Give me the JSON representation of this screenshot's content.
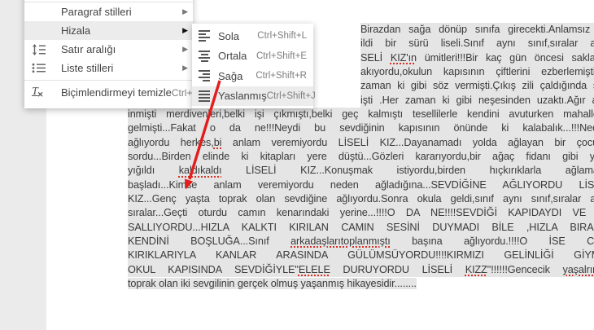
{
  "context_menu": {
    "items": [
      {
        "label": "Paragraf stilleri",
        "shortcut": "",
        "icon": "none",
        "has_submenu": true,
        "highlighted": false
      },
      {
        "label": "Hizala",
        "shortcut": "",
        "icon": "none",
        "has_submenu": true,
        "highlighted": true
      },
      {
        "label": "Satır aralığı",
        "shortcut": "",
        "icon": "line-spacing-icon",
        "has_submenu": true,
        "highlighted": false
      },
      {
        "label": "Liste stilleri",
        "shortcut": "",
        "icon": "list-icon",
        "has_submenu": true,
        "highlighted": false
      },
      {
        "label": "Biçimlendirmeyi temizle",
        "shortcut": "Ctrl+\\",
        "icon": "clear-formatting-icon",
        "has_submenu": false,
        "highlighted": false
      }
    ]
  },
  "align_submenu": {
    "items": [
      {
        "label": "Sola",
        "shortcut": "Ctrl+Shift+L",
        "icon": "align-left-icon",
        "highlighted": false
      },
      {
        "label": "Ortala",
        "shortcut": "Ctrl+Shift+E",
        "icon": "align-center-icon",
        "highlighted": false
      },
      {
        "label": "Sağa",
        "shortcut": "Ctrl+Shift+R",
        "icon": "align-right-icon",
        "highlighted": false
      },
      {
        "label": "Yaslanmış",
        "shortcut": "Ctrl+Shift+J",
        "icon": "align-justify-icon",
        "highlighted": true
      }
    ]
  },
  "document": {
    "selection_color": "#e5e5e5",
    "text_color": "#3a3a3a",
    "spellcheck_color": "#d93025",
    "fragment_lines": [
      [
        [
          "Birazdan sağa dönüp sınıfa girecekti.Anlamsız bir",
          false
        ]
      ],
      [
        [
          "ildi bir sürü liseli.Sınıf aynı sınıf,sıralar aynı",
          false
        ]
      ],
      [
        [
          "SELİ ",
          false
        ],
        [
          "KIZ'ın",
          true
        ],
        [
          " ümitleri!!!Bir kaç gün öncesi saklandı",
          false
        ]
      ],
      [
        [
          "akıyordu,okulun kapısının çiftlerini ezberlemişti,ne",
          false
        ]
      ],
      [
        [
          "zaman ki gibi söz vermişti.Çıkış zili çaldığında son",
          false
        ]
      ],
      [
        [
          "işti .Her zaman ki gibi neşesinden uzaktı.Ağır ağır",
          false
        ]
      ]
    ],
    "lines": [
      [
        [
          "inmişti merdivenleri,belki işi çıkmıştı,belki geç kalmıştı tesellilerle kendini avuturken mahalleye",
          false
        ]
      ],
      [
        [
          "gelmişti...Fakat o da ne!!!Neydi bu sevdiğinin kapısının önünde ki kalabalık...!!!Neden",
          false
        ]
      ],
      [
        [
          "ağlıyordu herkes,",
          false
        ],
        [
          "bi",
          true
        ],
        [
          " anlam veremiyordu LİSELİ KIZ...Dayanamadı yolda ağlayan bir çocuğa",
          false
        ]
      ],
      [
        [
          "sordu...Birden elinde ki kitapları yere düştü...Gözleri kararıyordu,bir ağaç fidanı gibi yere",
          false
        ]
      ],
      [
        [
          "yığıldı ",
          false
        ],
        [
          "kaldıkaldı",
          true
        ],
        [
          " LİSELİ KIZ...Konuşmak istiyordu,birden hıçkırıklarla ağlamaya",
          false
        ]
      ],
      [
        [
          "başladı...Kimse anlam veremiyordu neden ağladığına...SEVDİĞİNE AĞLIYORDU LİSELİ",
          false
        ]
      ],
      [
        [
          "KIZ...Genç yaşta toprak olan sevdiğine ağlıyordu.Sonra okula geldi,sınıf aynı sınıf,sıralar aynı",
          false
        ]
      ],
      [
        [
          "sıralar...Geçti oturdu camın kenarındaki yerine...!!!!O DA NE!!!!SEVDİĞİ KAPIDAYDI VE EL",
          false
        ]
      ],
      [
        [
          "SALLIYORDU...HIZLA KALKTI KIRILAN CAMIN SESİNİ DUYMADI BİLE ,HIZLA BIRAKTI",
          false
        ]
      ],
      [
        [
          "KENDİNİ BOŞLUĞA...Sınıf ",
          false
        ],
        [
          "arkadaşlarıtoplanmıştı",
          true
        ],
        [
          " başına ağlıyordu.!!!!O İSE CAM",
          false
        ]
      ],
      [
        [
          "KIRIKLARIYLA KANLAR ARASINDA GÜLÜMSÜYORDU!!!!KIRMIZI GELİNLİĞİ GİYMİŞ",
          false
        ]
      ],
      [
        [
          "OKUL KAPISINDA SEVDİĞİYLE\"",
          false
        ],
        [
          "ELELE",
          true
        ],
        [
          " DURUYORDU LİSELİ ",
          false
        ],
        [
          "KIZZ",
          true
        ],
        [
          "\"!!!!!!Gencecik ",
          false
        ],
        [
          "yaşalrında",
          true
        ]
      ],
      [
        [
          "toprak olan iki sevgilinin gerçek olmuş yaşanmış hikayesidir........",
          false
        ]
      ]
    ]
  },
  "annotation": {
    "arrow_color": "#e11d1d"
  }
}
